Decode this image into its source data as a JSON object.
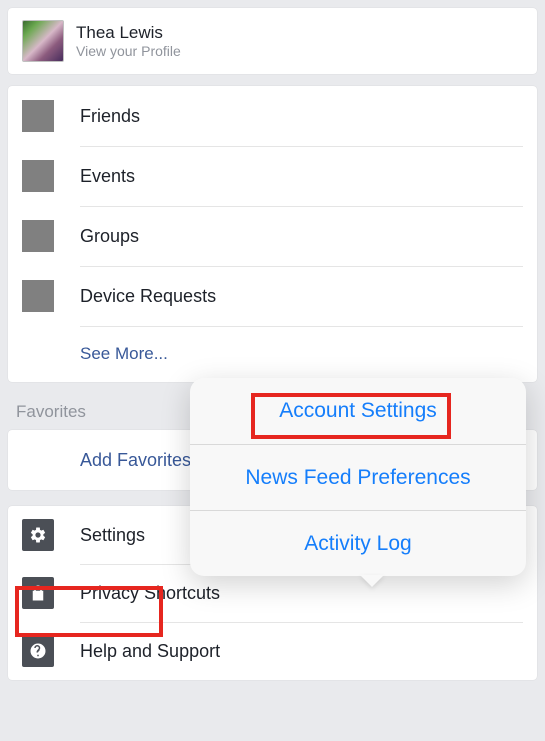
{
  "profile": {
    "name": "Thea Lewis",
    "subtitle": "View your Profile"
  },
  "nav": {
    "items": [
      {
        "label": "Friends"
      },
      {
        "label": "Events"
      },
      {
        "label": "Groups"
      },
      {
        "label": "Device Requests"
      }
    ],
    "see_more": "See More..."
  },
  "favorites": {
    "header": "Favorites",
    "add": "Add Favorites..."
  },
  "bottom": {
    "settings": "Settings",
    "privacy": "Privacy Shortcuts",
    "help": "Help and Support"
  },
  "popover": {
    "account_settings": "Account Settings",
    "news_feed": "News Feed Preferences",
    "activity_log": "Activity Log"
  }
}
